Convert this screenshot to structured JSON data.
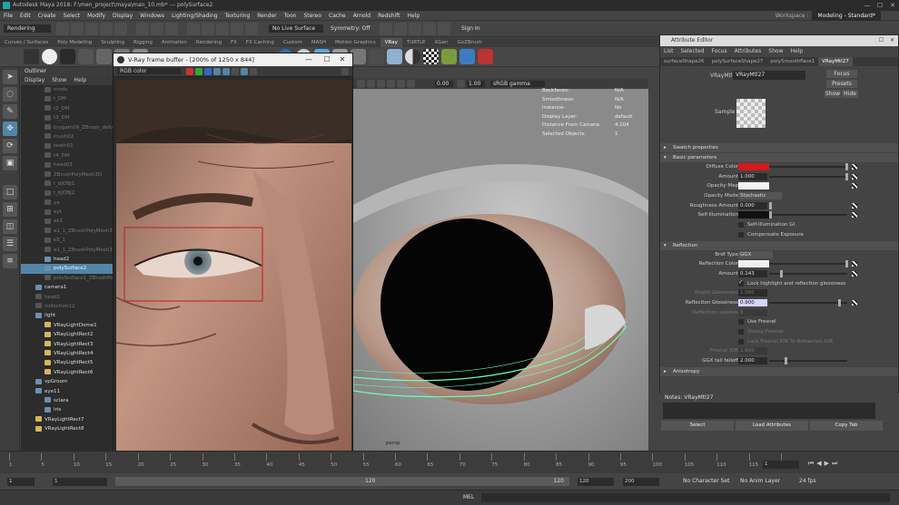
{
  "app": {
    "title": "Autodesk Maya 2018: F:\\men_project\\maya\\man_10.mb*  ---  polySurface2",
    "minimize": "—",
    "maximize": "☐",
    "close": "✕"
  },
  "menubar": [
    "File",
    "Edit",
    "Create",
    "Select",
    "Modify",
    "Display",
    "Windows",
    "Lighting/Shading",
    "Texturing",
    "Render",
    "Toon",
    "Stereo",
    "Cache",
    "Arnold",
    "Redshift",
    "Help"
  ],
  "workspace": {
    "label": "Workspace :",
    "value": "Modeling - Standard*"
  },
  "statusline": {
    "menuset": "Rendering",
    "live_surface": "No Live Surface",
    "symmetry": "Symmetry: Off",
    "sign_in": "Sign In"
  },
  "shelf_tabs": [
    "Curves / Surfaces",
    "Poly Modeling",
    "Sculpting",
    "Rigging",
    "Animation",
    "Rendering",
    "FX",
    "FX Caching",
    "Custom",
    "MASH",
    "Motion Graphics",
    "VRay",
    "TURTLE",
    "XGen",
    "GoZBrush"
  ],
  "shelf_active_tab": "VRay",
  "outliner": {
    "title": "Outliner",
    "menu": [
      "Display",
      "Show",
      "Help"
    ],
    "items": [
      {
        "label": "mods",
        "indent": 2,
        "state": "dim"
      },
      {
        "label": "t_DM",
        "indent": 2,
        "state": "dim"
      },
      {
        "label": "t2_DM",
        "indent": 2,
        "state": "dim"
      },
      {
        "label": "t3_DM",
        "indent": 2,
        "state": "dim"
      },
      {
        "label": "brygam09_ZBrush_defualt",
        "indent": 2,
        "state": "dim"
      },
      {
        "label": "mush02",
        "indent": 2,
        "state": "dim"
      },
      {
        "label": "teeth01",
        "indent": 2,
        "state": "dim"
      },
      {
        "label": "t4_DM",
        "indent": 2,
        "state": "dim"
      },
      {
        "label": "head03",
        "indent": 2,
        "state": "dim"
      },
      {
        "label": "ZBrushPolyMesh3D",
        "indent": 2,
        "state": "dim"
      },
      {
        "label": "t_bJOBJ1",
        "indent": 2,
        "state": "dim"
      },
      {
        "label": "t_bJOBJ2",
        "indent": 2,
        "state": "dim"
      },
      {
        "label": "ya",
        "indent": 2,
        "state": "dim"
      },
      {
        "label": "eyt",
        "indent": 2,
        "state": "dim"
      },
      {
        "label": "ek1",
        "indent": 2,
        "state": "dim"
      },
      {
        "label": "e1_1_ZBrushPolyMesh3D",
        "indent": 2,
        "state": "dim"
      },
      {
        "label": "e5_1",
        "indent": 2,
        "state": "dim"
      },
      {
        "label": "e1_1_ZBrushPolyMesh3D",
        "indent": 2,
        "state": "dim"
      },
      {
        "label": "head2",
        "indent": 2,
        "state": "on"
      },
      {
        "label": "polySurface2",
        "indent": 2,
        "state": "sel"
      },
      {
        "label": "polySurface1_ZBrushPolyMesh3D",
        "indent": 2,
        "state": "dim"
      },
      {
        "label": "camera1",
        "indent": 1,
        "state": "on"
      },
      {
        "label": "head1",
        "indent": 1,
        "state": "dim"
      },
      {
        "label": "collection12",
        "indent": 1,
        "state": "dim"
      },
      {
        "label": "light",
        "indent": 1,
        "state": "on"
      },
      {
        "label": "VRayLightDome1",
        "indent": 2,
        "state": "on"
      },
      {
        "label": "VRayLightRect2",
        "indent": 2,
        "state": "on"
      },
      {
        "label": "VRayLightRect3",
        "indent": 2,
        "state": "on"
      },
      {
        "label": "VRayLightRect4",
        "indent": 2,
        "state": "on"
      },
      {
        "label": "VRayLightRect5",
        "indent": 2,
        "state": "on"
      },
      {
        "label": "VRayLightRect6",
        "indent": 2,
        "state": "on"
      },
      {
        "label": "vpGroom",
        "indent": 1,
        "state": "on"
      },
      {
        "label": "eye11",
        "indent": 1,
        "state": "on"
      },
      {
        "label": "sclara",
        "indent": 2,
        "state": "on"
      },
      {
        "label": "iris",
        "indent": 2,
        "state": "on"
      },
      {
        "label": "VRayLightRect7",
        "indent": 1,
        "state": "on"
      },
      {
        "label": "VRayLightRect8",
        "indent": 1,
        "state": "on"
      }
    ]
  },
  "vfb": {
    "title": "V-Ray frame buffer - [200% of 1250 x 844]",
    "channel": "RGB color"
  },
  "viewport": {
    "toolbar_values": [
      "0.00",
      "1.00"
    ],
    "color_space": "sRGB gamma",
    "camera_label": "persp",
    "hud": [
      {
        "key": "Backfaces:",
        "value": "N/A"
      },
      {
        "key": "Smoothness:",
        "value": "N/A"
      },
      {
        "key": "Instance:",
        "value": "No"
      },
      {
        "key": "Display Layer:",
        "value": "default"
      },
      {
        "key": "Distance From Camera:",
        "value": "4.104"
      },
      {
        "key": "Selected Objects:",
        "value": "1"
      }
    ]
  },
  "attribute_editor": {
    "title": "Attribute Editor",
    "menu": [
      "List",
      "Selected",
      "Focus",
      "Attributes",
      "Show",
      "Help"
    ],
    "tabs": [
      "surfaceShape26",
      "polySurfaceShape27",
      "polySmoothFace1",
      "VRayMtl27"
    ],
    "active_tab": "VRayMtl27",
    "node_label": "VRayMtl:",
    "node_name": "VRayMtl27",
    "buttons": {
      "focus": "Focus",
      "presets": "Presets",
      "show": "Show",
      "hide": "Hide"
    },
    "sample_label": "Sample",
    "sections": {
      "swatch": "Swatch properties",
      "basic": "Basic parameters",
      "reflection": "Reflection",
      "anisotropy": "Anisotropy"
    },
    "basic": {
      "diffuse_color": {
        "label": "Diffuse Color",
        "color": "#d11b1b"
      },
      "amount": {
        "label": "Amount",
        "value": "1.000",
        "level": 1.0
      },
      "opacity_map": {
        "label": "Opacity Map",
        "color": "#f2f2f2"
      },
      "opacity_mode": {
        "label": "Opacity Mode",
        "value": "Stochastic"
      },
      "roughness": {
        "label": "Roughness Amount",
        "value": "0.000",
        "level": 0.0
      },
      "self_illum": {
        "label": "Self-Illumination",
        "color": "#111111"
      },
      "self_illum_gi": "Self-Illumination GI",
      "compensate": "Compensate Exposure"
    },
    "reflection": {
      "brdf_type": {
        "label": "Brdf Type",
        "value": "GGX"
      },
      "reflection_color": {
        "label": "Reflection Color",
        "color": "#f0f0f0"
      },
      "amount": {
        "label": "Amount",
        "value": "0.143",
        "level": 0.143
      },
      "lock_highlight": "Lock highlight and reflection glossiness",
      "highlight_glossiness": {
        "label": "Hilight Glossiness",
        "value": "1.000"
      },
      "reflection_glossiness": {
        "label": "Reflection Glossiness",
        "value": "0.900",
        "level": 0.9
      },
      "reflection_subdivs": {
        "label": "Reflection subdivs",
        "value": "8"
      },
      "use_fresnel": "Use Fresnel",
      "glossy_fresnel": "Glossy Fresnel",
      "lock_fresnel_ior": "Lock Fresnel IOR To Refraction IOR",
      "fresnel_ior": {
        "label": "Fresnel IOR",
        "value": "1.600"
      },
      "ggx_tail": {
        "label": "GGX tail falloff",
        "value": "2.000",
        "level": 0.2
      }
    },
    "notes_label": "Notes: VRayMtl27",
    "footer": {
      "select": "Select",
      "load": "Load Attributes",
      "copy": "Copy Tab"
    }
  },
  "timeline": {
    "ticks": [
      "1",
      "5",
      "10",
      "15",
      "20",
      "25",
      "30",
      "35",
      "40",
      "45",
      "50",
      "55",
      "60",
      "65",
      "70",
      "75",
      "80",
      "85",
      "90",
      "95",
      "100",
      "105",
      "110",
      "115",
      "120"
    ],
    "current_frame": "1"
  },
  "range": {
    "start": "1",
    "playback_start": "1",
    "range_end": "120",
    "end": "120",
    "anim_end": "200",
    "character_set": "No Character Set",
    "anim_layer": "No Anim Layer",
    "fps": "24 fps"
  },
  "cmdline": {
    "lang": "MEL"
  },
  "colors": {
    "accent": "#5285a6",
    "wireframe": "#6bffb0",
    "select_box": "#c01a1a"
  }
}
